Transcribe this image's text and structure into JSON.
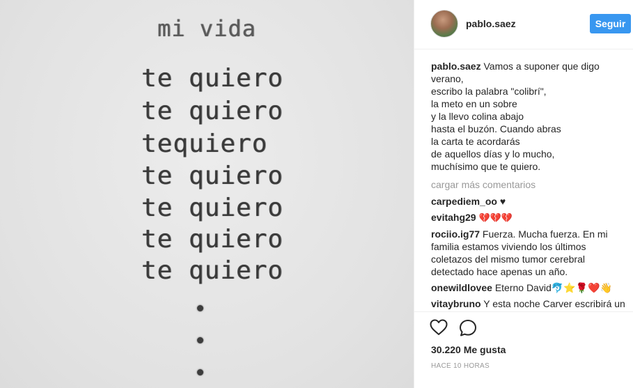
{
  "photo": {
    "title": "mi vida",
    "lines": [
      "te quiero",
      "te quiero",
      "tequiero",
      "te quiero",
      "te quiero",
      "te quiero",
      "te quiero"
    ]
  },
  "header": {
    "username": "pablo.saez",
    "follow_label": "Seguir"
  },
  "caption": {
    "author": "pablo.saez",
    "lines": [
      "Vamos a suponer que digo",
      "verano,",
      "escribo la palabra \"colibrí\",",
      "la meto en un sobre",
      "y la llevo colina abajo",
      "hasta el buzón. Cuando abras",
      "la carta te acordarás",
      "de aquellos días y lo mucho,",
      "muchísimo que te quiero."
    ]
  },
  "load_more": "cargar más comentarios",
  "comments": [
    {
      "user": "carpediem_oo",
      "text": "♥"
    },
    {
      "user": "evitahg29",
      "text": "💔💔💔"
    },
    {
      "user": "rociio.ig77",
      "text": "Fuerza. Mucha fuerza. En mi familia estamos viviendo los últimos coletazos del mismo tumor cerebral detectado hace apenas un año."
    },
    {
      "user": "onewildlovee",
      "text": "Eterno David🐬⭐🌹❤️👋"
    },
    {
      "user": "vitaybruno",
      "text": "Y esta noche Carver escribirá un"
    }
  ],
  "actions": {
    "like_icon": "heart-outline-icon",
    "comment_icon": "speech-bubble-icon",
    "likes": "30.220 Me gusta",
    "timestamp": "HACE 10 HORAS"
  },
  "colors": {
    "accent": "#3897f0",
    "muted": "#999999",
    "text": "#262626"
  }
}
